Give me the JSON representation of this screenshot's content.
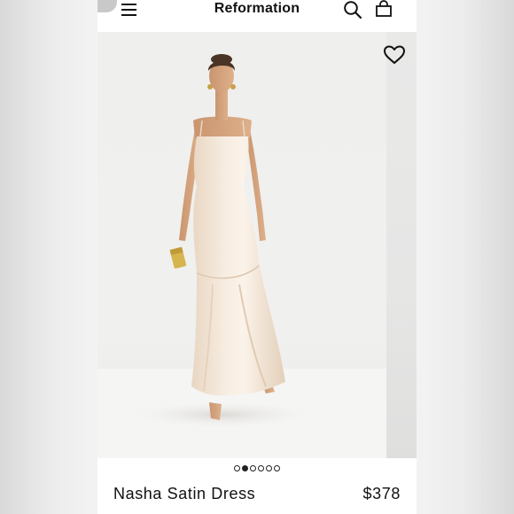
{
  "header": {
    "brand": "Reformation",
    "icons": [
      "menu-icon",
      "search-icon",
      "shopping-bag-icon"
    ]
  },
  "product": {
    "name": "Nasha Satin Dress",
    "price": "$378",
    "wishlist_icon": "heart-outline-icon",
    "image_description_icon": "product-photo"
  },
  "carousel": {
    "total": 6,
    "active_index": 1
  },
  "colors": {
    "text": "#111111",
    "dress": "#f3e6d6"
  }
}
